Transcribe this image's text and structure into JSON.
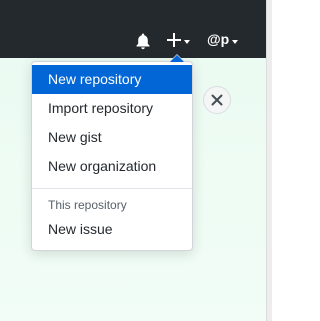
{
  "header": {
    "notifications_icon": "bell-icon",
    "create_icon": "plus-icon",
    "user_handle": "@p"
  },
  "dropdown": {
    "items": [
      {
        "label": "New repository",
        "active": true
      },
      {
        "label": "Import repository"
      },
      {
        "label": "New gist"
      },
      {
        "label": "New organization"
      }
    ],
    "section_header": "This repository",
    "section_items": [
      {
        "label": "New issue"
      }
    ]
  },
  "colors": {
    "header_bg": "#24292e",
    "accent": "#0366d6",
    "page_bg": "#eafaf1"
  },
  "close_icon": "close-icon"
}
